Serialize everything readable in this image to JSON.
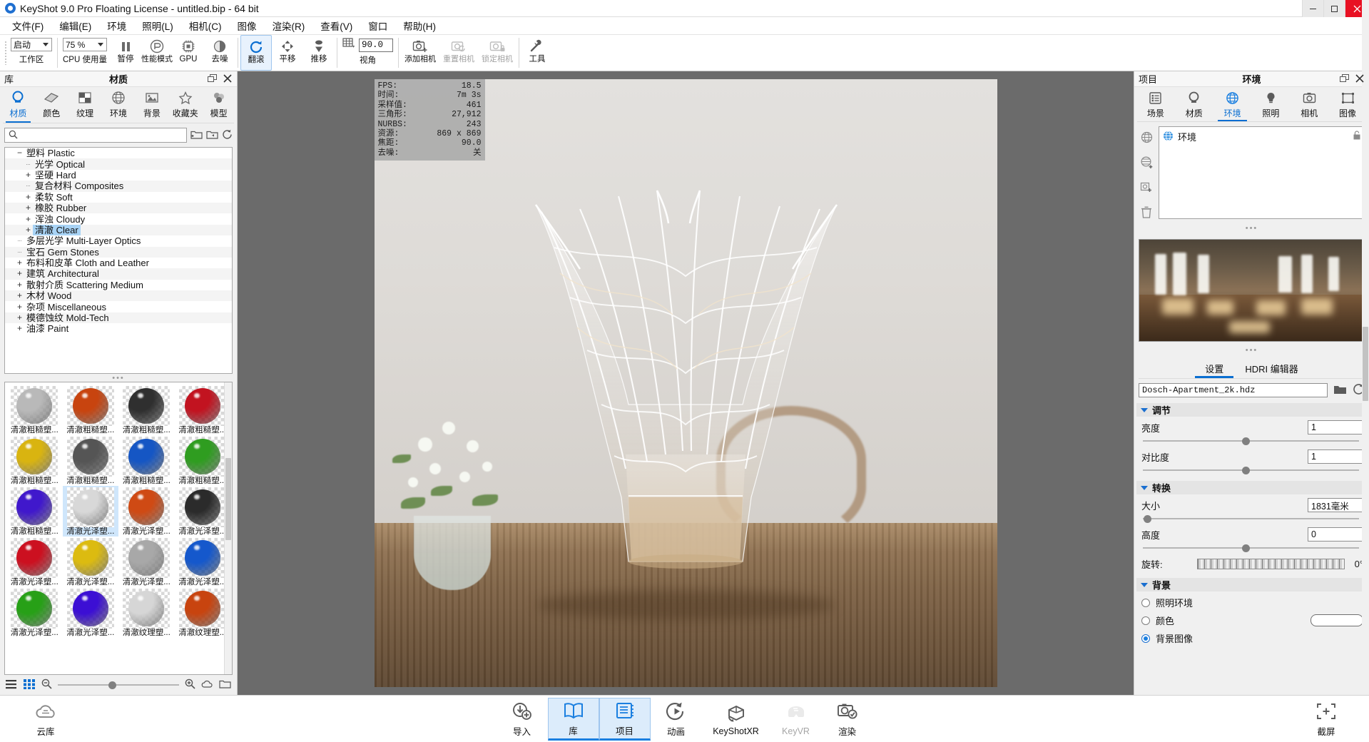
{
  "titlebar": {
    "title": "KeyShot 9.0 Pro Floating License  - untitled.bip  - 64 bit",
    "minimize": "–",
    "maximize": "□",
    "close": "✕"
  },
  "menubar": {
    "items": [
      {
        "label": "文件(F)"
      },
      {
        "label": "编辑(E)"
      },
      {
        "label": "环境"
      },
      {
        "label": "照明(L)"
      },
      {
        "label": "相机(C)"
      },
      {
        "label": "图像"
      },
      {
        "label": "渲染(R)"
      },
      {
        "label": "查看(V)"
      },
      {
        "label": "窗口"
      },
      {
        "label": "帮助(H)"
      }
    ]
  },
  "toolbar": {
    "workspace_value": "启动",
    "workspace_label": "工作区",
    "cpu_value": "75 %",
    "cpu_label": "CPU 使用量",
    "pause_label": "暂停",
    "perf_label": "性能模式",
    "gpu_label": "GPU",
    "denoise_label": "去噪",
    "roll_label": "翻滚",
    "pan_label": "平移",
    "dolly_label": "推移",
    "fov_value": "90.0",
    "fov_label": "视角",
    "addcam_label": "添加相机",
    "resetcam_label": "重置相机",
    "lockcam_label": "锁定相机",
    "tools_label": "工具"
  },
  "library": {
    "panel_left": "库",
    "panel_title": "材质",
    "tabs": [
      {
        "label": "材质",
        "icon": "material-icon",
        "selected": true
      },
      {
        "label": "颜色",
        "icon": "color-icon",
        "selected": false
      },
      {
        "label": "纹理",
        "icon": "texture-icon",
        "selected": false
      },
      {
        "label": "环境",
        "icon": "environment-icon",
        "selected": false
      },
      {
        "label": "背景",
        "icon": "backplate-icon",
        "selected": false
      },
      {
        "label": "收藏夹",
        "icon": "favorites-icon",
        "selected": false
      },
      {
        "label": "模型",
        "icon": "model-icon",
        "selected": false
      }
    ],
    "search_placeholder": "",
    "search_value": "",
    "tree": [
      {
        "label": "塑料 Plastic",
        "level": 1,
        "toggle": "−",
        "selected": false
      },
      {
        "label": "光学 Optical",
        "level": 2,
        "toggle": "",
        "selected": false
      },
      {
        "label": "坚硬 Hard",
        "level": 2,
        "toggle": "+",
        "selected": false
      },
      {
        "label": "复合材料 Composites",
        "level": 2,
        "toggle": "",
        "selected": false
      },
      {
        "label": "柔软 Soft",
        "level": 2,
        "toggle": "+",
        "selected": false
      },
      {
        "label": "橡胶 Rubber",
        "level": 2,
        "toggle": "+",
        "selected": false
      },
      {
        "label": "浑浊 Cloudy",
        "level": 2,
        "toggle": "+",
        "selected": false
      },
      {
        "label": "清澈 Clear",
        "level": 2,
        "toggle": "+",
        "selected": true
      },
      {
        "label": "多层光学 Multi-Layer Optics",
        "level": 1,
        "toggle": "",
        "selected": false
      },
      {
        "label": "宝石 Gem Stones",
        "level": 1,
        "toggle": "",
        "selected": false
      },
      {
        "label": "布料和皮革 Cloth and Leather",
        "level": 1,
        "toggle": "+",
        "selected": false
      },
      {
        "label": "建筑 Architectural",
        "level": 1,
        "toggle": "+",
        "selected": false
      },
      {
        "label": "散射介质 Scattering Medium",
        "level": 1,
        "toggle": "+",
        "selected": false
      },
      {
        "label": "木材 Wood",
        "level": 1,
        "toggle": "+",
        "selected": false
      },
      {
        "label": "杂项 Miscellaneous",
        "level": 1,
        "toggle": "+",
        "selected": false
      },
      {
        "label": "模德蚀纹 Mold-Tech",
        "level": 1,
        "toggle": "+",
        "selected": false
      },
      {
        "label": "油漆 Paint",
        "level": 1,
        "toggle": "+",
        "selected": false
      }
    ],
    "materials": [
      {
        "label": "清澈粗糙塑...",
        "color": "#b9b9b9",
        "selected": false
      },
      {
        "label": "清澈粗糙塑...",
        "color": "#c8440f",
        "selected": false
      },
      {
        "label": "清澈粗糙塑...",
        "color": "#2f2f2f",
        "selected": false
      },
      {
        "label": "清澈粗糙塑...",
        "color": "#c21320",
        "selected": false
      },
      {
        "label": "清澈粗糙塑...",
        "color": "#d9b410",
        "selected": false
      },
      {
        "label": "清澈粗糙塑...",
        "color": "#555555",
        "selected": false
      },
      {
        "label": "清澈粗糙塑...",
        "color": "#1556c4",
        "selected": false
      },
      {
        "label": "清澈粗糙塑...",
        "color": "#2f9d20",
        "selected": false
      },
      {
        "label": "清澈粗糙塑...",
        "color": "#4018cc",
        "selected": false
      },
      {
        "label": "清澈光泽塑...",
        "color": "#d8d8d8",
        "selected": true
      },
      {
        "label": "清澈光泽塑...",
        "color": "#cf4a14",
        "selected": false
      },
      {
        "label": "清澈光泽塑...",
        "color": "#2b2b2b",
        "selected": false
      },
      {
        "label": "清澈光泽塑...",
        "color": "#cc1020",
        "selected": false
      },
      {
        "label": "清澈光泽塑...",
        "color": "#dcbb10",
        "selected": false
      },
      {
        "label": "清澈光泽塑...",
        "color": "#a8a8a8",
        "selected": false
      },
      {
        "label": "清澈光泽塑...",
        "color": "#1558cc",
        "selected": false
      },
      {
        "label": "清澈光泽塑...",
        "color": "#27a017",
        "selected": false
      },
      {
        "label": "清澈光泽塑...",
        "color": "#3c0fd4",
        "selected": false
      },
      {
        "label": "清澈纹理塑...",
        "color": "#d6d6d6",
        "selected": false
      },
      {
        "label": "清澈纹理塑...",
        "color": "#c8440f",
        "selected": false
      }
    ]
  },
  "stats": {
    "rows": [
      {
        "key": "FPS:",
        "value": "18.5"
      },
      {
        "key": "时间:",
        "value": "7m 3s"
      },
      {
        "key": "采样值:",
        "value": "461"
      },
      {
        "key": "三角形:",
        "value": "27,912"
      },
      {
        "key": "NURBS:",
        "value": "243"
      },
      {
        "key": "资源:",
        "value": "869 x 869"
      },
      {
        "key": "焦距:",
        "value": "90.0"
      },
      {
        "key": "去噪:",
        "value": "关"
      }
    ]
  },
  "project": {
    "panel_left": "项目",
    "panel_title": "环境",
    "tabs": [
      {
        "label": "场景",
        "icon": "scene-icon",
        "selected": false
      },
      {
        "label": "材质",
        "icon": "material-icon",
        "selected": false
      },
      {
        "label": "环境",
        "icon": "environment-icon",
        "selected": true
      },
      {
        "label": "照明",
        "icon": "lighting-icon",
        "selected": false
      },
      {
        "label": "相机",
        "icon": "camera-icon",
        "selected": false
      },
      {
        "label": "图像",
        "icon": "image-icon",
        "selected": false
      }
    ],
    "env_item": "环境",
    "settings_tabs": [
      {
        "label": "设置",
        "selected": true
      },
      {
        "label": "HDRI 编辑器",
        "selected": false
      }
    ],
    "hdri_file": "Dosch-Apartment_2k.hdz",
    "section_adjust": "调节",
    "brightness_label": "亮度",
    "brightness_value": "1",
    "contrast_label": "对比度",
    "contrast_value": "1",
    "section_transform": "转换",
    "size_label": "大小",
    "size_value": "1831毫米",
    "height_label": "高度",
    "height_value": "0",
    "rotation_label": "旋转:",
    "rotation_value": "0°",
    "section_background": "背景",
    "bg_options": [
      {
        "label": "照明环境",
        "selected": false
      },
      {
        "label": "颜色",
        "selected": false
      },
      {
        "label": "背景图像",
        "selected": true
      }
    ]
  },
  "bottombar": {
    "cloud_label": "云库",
    "items": [
      {
        "label": "导入",
        "icon": "import-icon",
        "selected": false,
        "disabled": false
      },
      {
        "label": "库",
        "icon": "library-icon",
        "selected": true,
        "disabled": false
      },
      {
        "label": "项目",
        "icon": "project-icon",
        "selected": true,
        "disabled": false
      },
      {
        "label": "动画",
        "icon": "animation-icon",
        "selected": false,
        "disabled": false
      },
      {
        "label": "KeyShotXR",
        "icon": "keyshotxr-icon",
        "selected": false,
        "disabled": false
      },
      {
        "label": "KeyVR",
        "icon": "keyvr-icon",
        "selected": false,
        "disabled": true
      },
      {
        "label": "渲染",
        "icon": "render-icon",
        "selected": false,
        "disabled": false
      }
    ],
    "screenshot_label": "截屏"
  },
  "colors": {
    "accent": "#0a6ed1",
    "selection": "#a8d3f5",
    "titlebar_close": "#e81123"
  }
}
